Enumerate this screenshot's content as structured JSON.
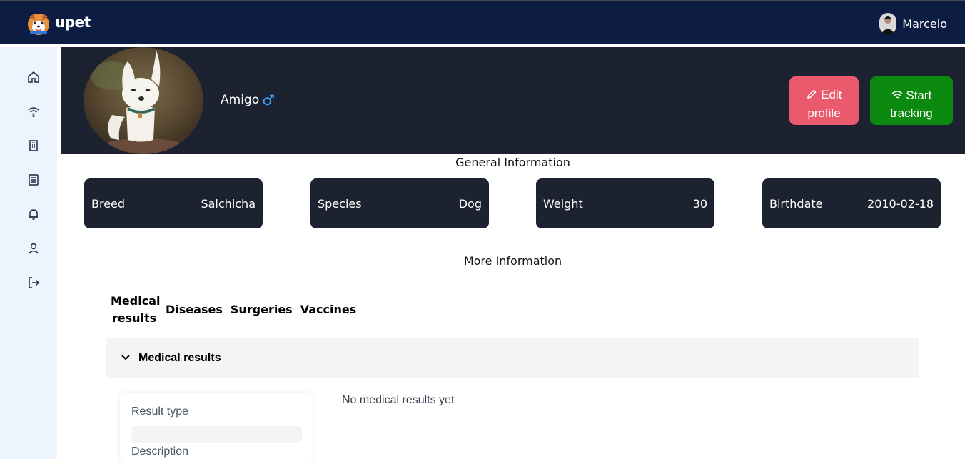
{
  "app": {
    "brand": "upet"
  },
  "user": {
    "name": "Marcelo"
  },
  "sidebar": {
    "icons": [
      "home-icon",
      "wifi-icon",
      "building-icon",
      "document-icon",
      "bell-icon",
      "user-icon",
      "logout-icon"
    ]
  },
  "pet": {
    "name": "Amigo",
    "gender_symbol": "♂"
  },
  "actions": {
    "edit_label": "Edit profile",
    "track_label": "Start tracking"
  },
  "general": {
    "title": "General Information",
    "cards": [
      {
        "label": "Breed",
        "value": "Salchicha"
      },
      {
        "label": "Species",
        "value": "Dog"
      },
      {
        "label": "Weight",
        "value": "30"
      },
      {
        "label": "Birthdate",
        "value": "2010-02-18"
      }
    ]
  },
  "more": {
    "title": "More Information",
    "tabs": [
      "Medical results",
      "Diseases",
      "Surgeries",
      "Vaccines"
    ]
  },
  "medical": {
    "section_label": "Medical results",
    "result_type_label": "Result type",
    "description_label": "Description",
    "empty_message": "No medical results yet"
  },
  "colors": {
    "topbar": "#0c1c43",
    "hero": "#1c2230",
    "edit_button": "#ea5a6c",
    "track_button": "#0b8a0f",
    "gender": "#3ea1ff"
  }
}
